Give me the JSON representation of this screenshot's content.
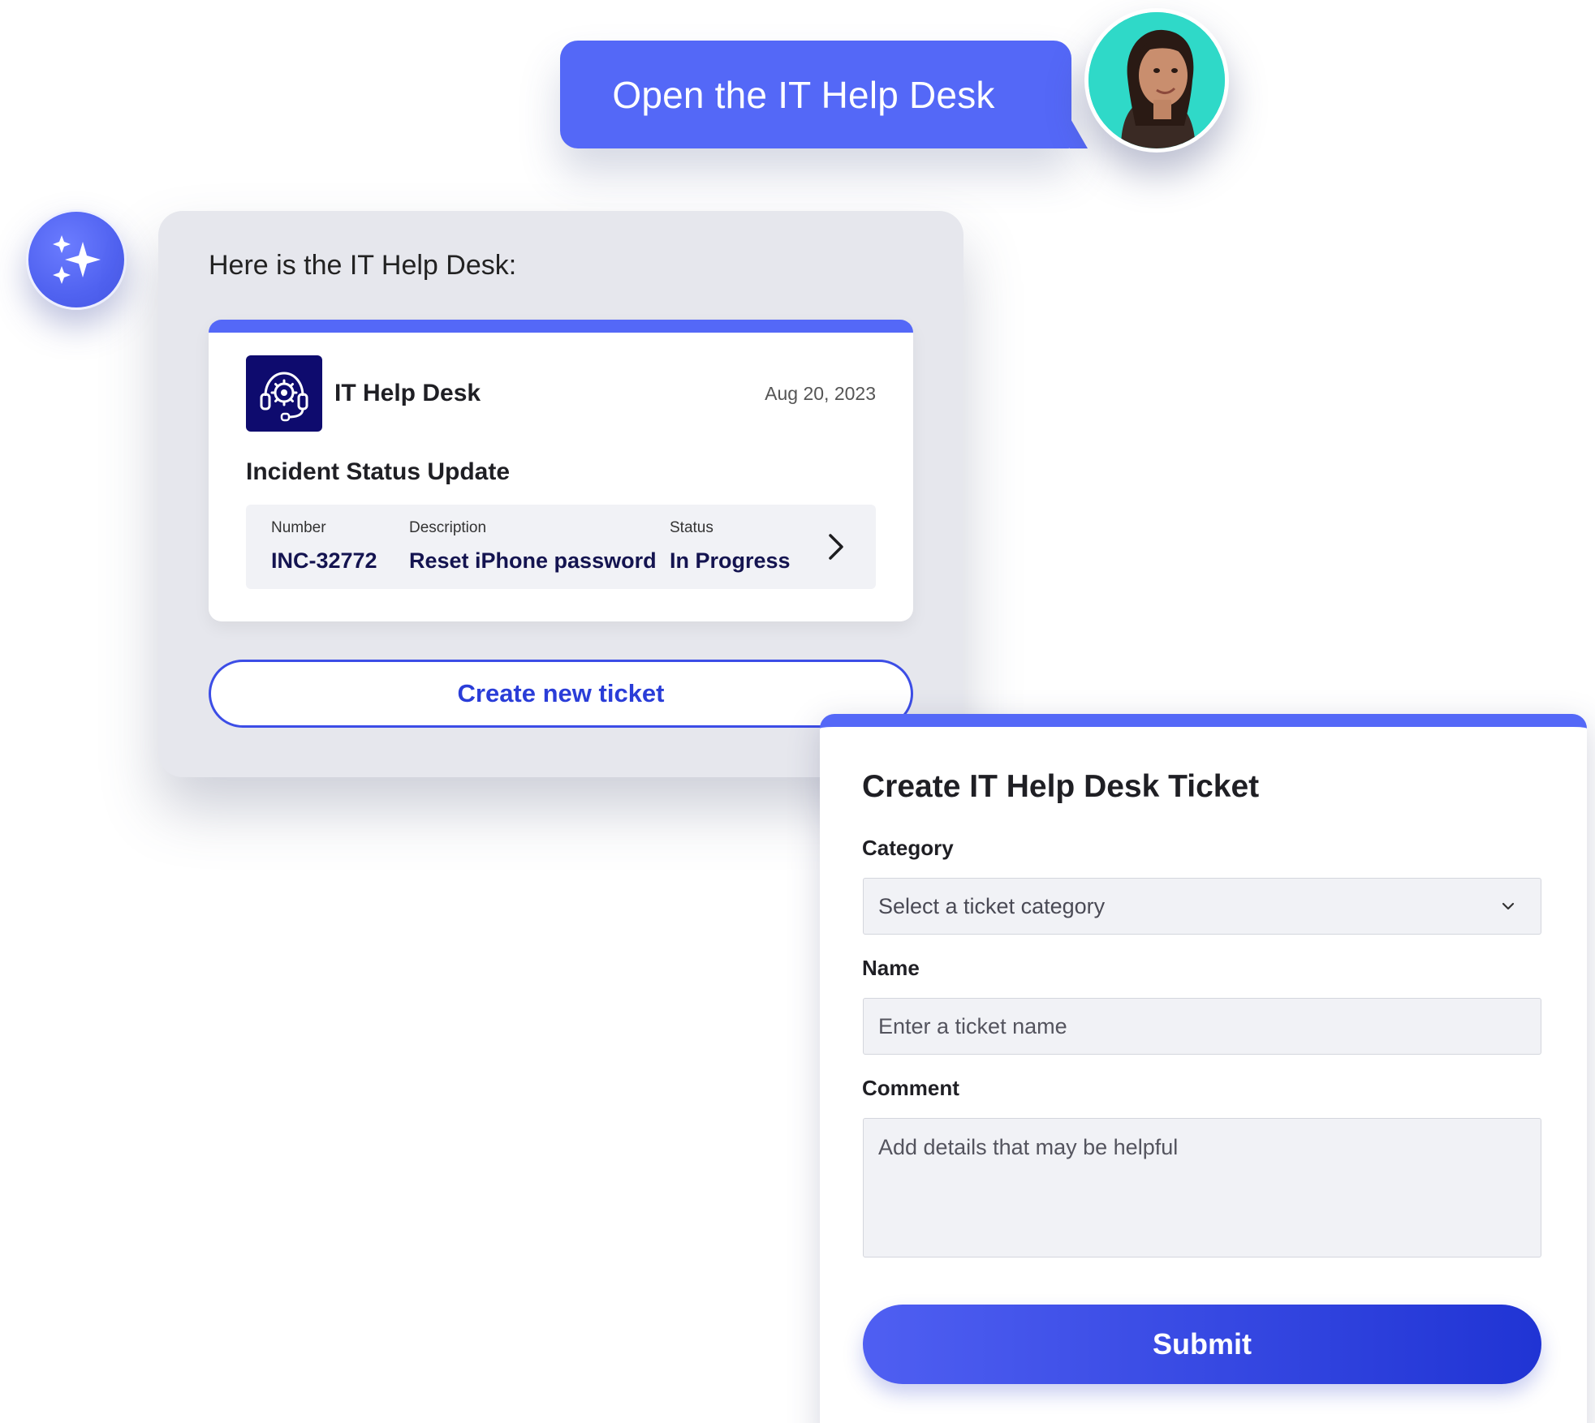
{
  "user_message": {
    "text": "Open the IT Help Desk"
  },
  "assistant": {
    "intro": "Here is the IT Help Desk:",
    "card": {
      "app_name": "IT Help Desk",
      "date": "Aug 20, 2023",
      "heading": "Incident Status Update",
      "incident": {
        "number_label": "Number",
        "number_value": "INC-32772",
        "description_label": "Description",
        "description_value": "Reset iPhone password",
        "status_label": "Status",
        "status_value": "In Progress"
      }
    },
    "new_ticket_button": "Create new ticket"
  },
  "form": {
    "title": "Create IT Help Desk Ticket",
    "category": {
      "label": "Category",
      "placeholder": "Select a ticket category"
    },
    "name": {
      "label": "Name",
      "placeholder": "Enter a ticket name"
    },
    "comment": {
      "label": "Comment",
      "placeholder": "Add details that may be helpful"
    },
    "submit_label": "Submit"
  },
  "icons": {
    "assistant_badge": "sparkles-icon",
    "app_logo": "headset-gear-icon",
    "row_chevron": "chevron-right-icon",
    "select_chevron": "chevron-down-icon"
  },
  "colors": {
    "accent": "#5468f7",
    "button_primary": "#2034d4",
    "app_logo_bg": "#0e0b6e",
    "panel_bg": "#e6e7ed",
    "avatar_bg": "#2fd9c8"
  }
}
